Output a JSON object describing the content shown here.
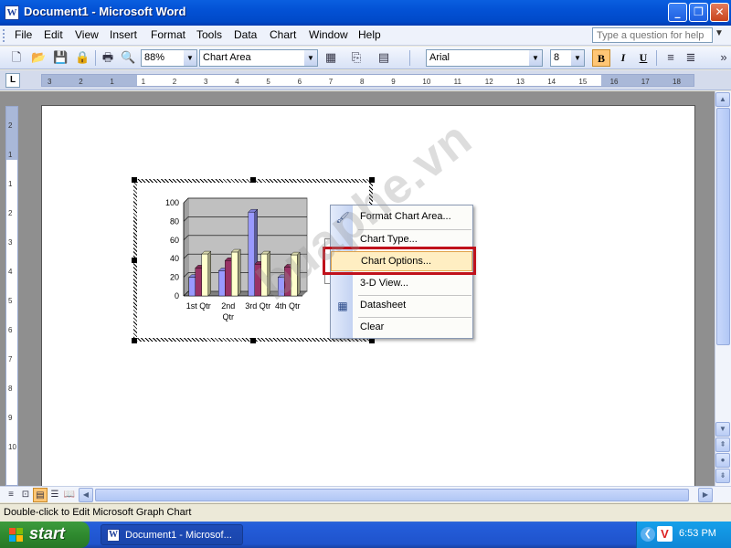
{
  "window": {
    "title": "Document1 - Microsoft Word",
    "colors": {
      "titlebar": "#0054e3",
      "highlight": "#ffc675"
    }
  },
  "menubar": {
    "items": [
      "File",
      "Edit",
      "View",
      "Insert",
      "Format",
      "Tools",
      "Data",
      "Chart",
      "Window",
      "Help"
    ],
    "ask_placeholder": "Type a question for help"
  },
  "toolbar": {
    "zoom": "88%",
    "chart_object": "Chart Area",
    "font": "Arial",
    "font_size": "8",
    "bold_label": "B",
    "italic_label": "I",
    "underline_label": "U"
  },
  "ruler": {
    "h_labels": [
      "3",
      "2",
      "1",
      "1",
      "2",
      "3",
      "4",
      "5",
      "6",
      "7",
      "8",
      "9",
      "10",
      "11",
      "12",
      "13",
      "14",
      "15",
      "16",
      "17",
      "18"
    ],
    "v_labels": [
      "2",
      "1",
      "1",
      "2",
      "3",
      "4",
      "5",
      "6",
      "7",
      "8",
      "9",
      "10"
    ],
    "tab_selector": "L"
  },
  "chart_data": {
    "type": "bar",
    "categories": [
      "1st Qtr",
      "2nd Qtr",
      "3rd Qtr",
      "4th Qtr"
    ],
    "series": [
      {
        "values": [
          20,
          27,
          90,
          20
        ],
        "color": "#9999ff"
      },
      {
        "values": [
          30,
          38,
          34,
          31
        ],
        "color": "#993366"
      },
      {
        "values": [
          45,
          47,
          45,
          44
        ],
        "color": "#ffffcc"
      }
    ],
    "ylim": [
      0,
      100
    ],
    "yticks": [
      "0",
      "20",
      "40",
      "60",
      "80",
      "100"
    ],
    "category_labels": [
      "1st Qtr",
      "2nd",
      "Qtr",
      "3rd Qtr",
      "4th Qtr"
    ],
    "plot_bg": "#c0c0c0",
    "grid": true
  },
  "context_menu": {
    "items": [
      {
        "label": "Format Chart Area...",
        "icon": "format-icon"
      },
      {
        "label": "Chart Type...",
        "icon": ""
      },
      {
        "label": "Chart Options...",
        "icon": "",
        "highlighted": true
      },
      {
        "label": "3-D View...",
        "icon": ""
      },
      {
        "label": "Datasheet",
        "icon": "datasheet-icon"
      },
      {
        "label": "Clear",
        "icon": ""
      }
    ]
  },
  "status_bar": {
    "text": "Double-click to Edit Microsoft Graph Chart"
  },
  "taskbar": {
    "start_label": "start",
    "task_label": "Document1 - Microsof...",
    "clock": "6:53 PM",
    "tray_app": "V"
  },
  "watermark": "buaphe.vn"
}
